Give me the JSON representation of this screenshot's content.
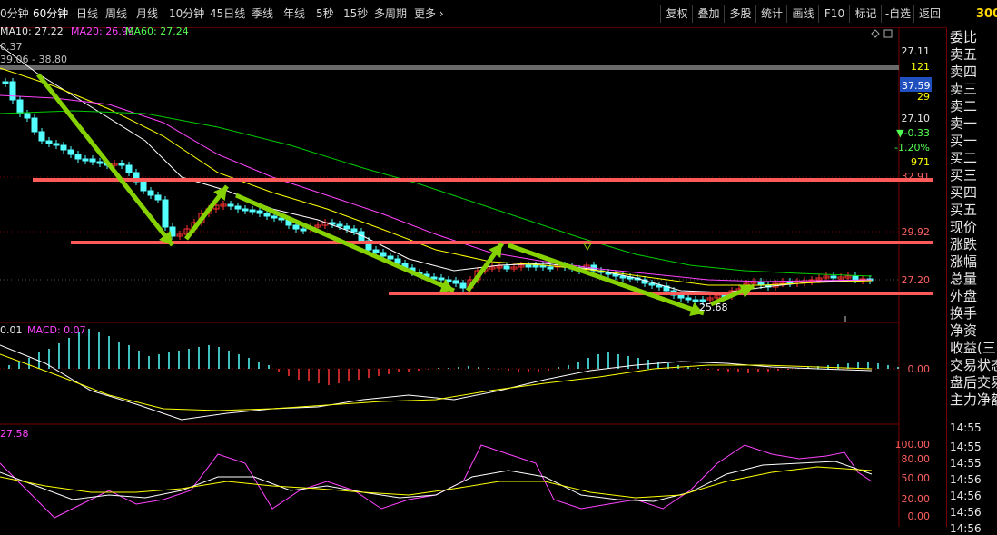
{
  "toolbar": {
    "periods": [
      "0分钟",
      "60分钟",
      "日线",
      "周线",
      "月线",
      "10分钟",
      "45日线",
      "季线",
      "年线",
      "5秒",
      "15秒",
      "多周期",
      "更多 ›"
    ],
    "buttons": [
      "复权",
      "叠加",
      "多股",
      "统计",
      "画线",
      "F10",
      "标记",
      "-自选",
      "返回"
    ],
    "stock_code_partial": "300"
  },
  "legend": {
    "ma10": "MA10: 27.22",
    "ma20": "MA20: 26.99",
    "ma60": "MA60: 27.24",
    "line2": "0.37",
    "line3": "39.06 - 38.80",
    "macd_label_left": "0.01",
    "macd_label": "MACD: 0.07",
    "kdj_label": "27.58"
  },
  "price_axis": {
    "ask_price": "27.11",
    "ask_vol": "121",
    "price_box": "37.59",
    "p29": "29",
    "last": "27.10",
    "change": "▼-0.33",
    "change_pct": "-1.20%",
    "vol": "971",
    "l3291": "32.91",
    "l2992": "29.92",
    "l2720": "27.20",
    "low_label": "25.68",
    "macd_zero": "0.00",
    "kdj_100": "100.00",
    "kdj_80": "80.00",
    "kdj_50": "50.00",
    "kdj_20": "20.00",
    "kdj_0": "0.00"
  },
  "right_panel": {
    "labels": [
      "委比",
      "卖五",
      "卖四",
      "卖三",
      "卖二",
      "卖一",
      "买一",
      "买二",
      "买三",
      "买四",
      "买五",
      "现价",
      "涨跌",
      "涨幅",
      "总量",
      "外盘",
      "换手",
      "净资",
      "收益(三)",
      "交易状态",
      "盘后交易",
      "主力净额"
    ],
    "times": [
      "14:55",
      "14:55",
      "14:55",
      "14:56",
      "14:56",
      "14:56",
      "14:56"
    ]
  },
  "colors": {
    "up": "#ff3333",
    "down": "#54ffff",
    "ma10": "#ffffff",
    "ma20": "#ffff00",
    "ma60": "#ff44ff",
    "ma120": "#00cc00",
    "arrow": "#86d200",
    "hline": "#ff5a5a"
  }
}
